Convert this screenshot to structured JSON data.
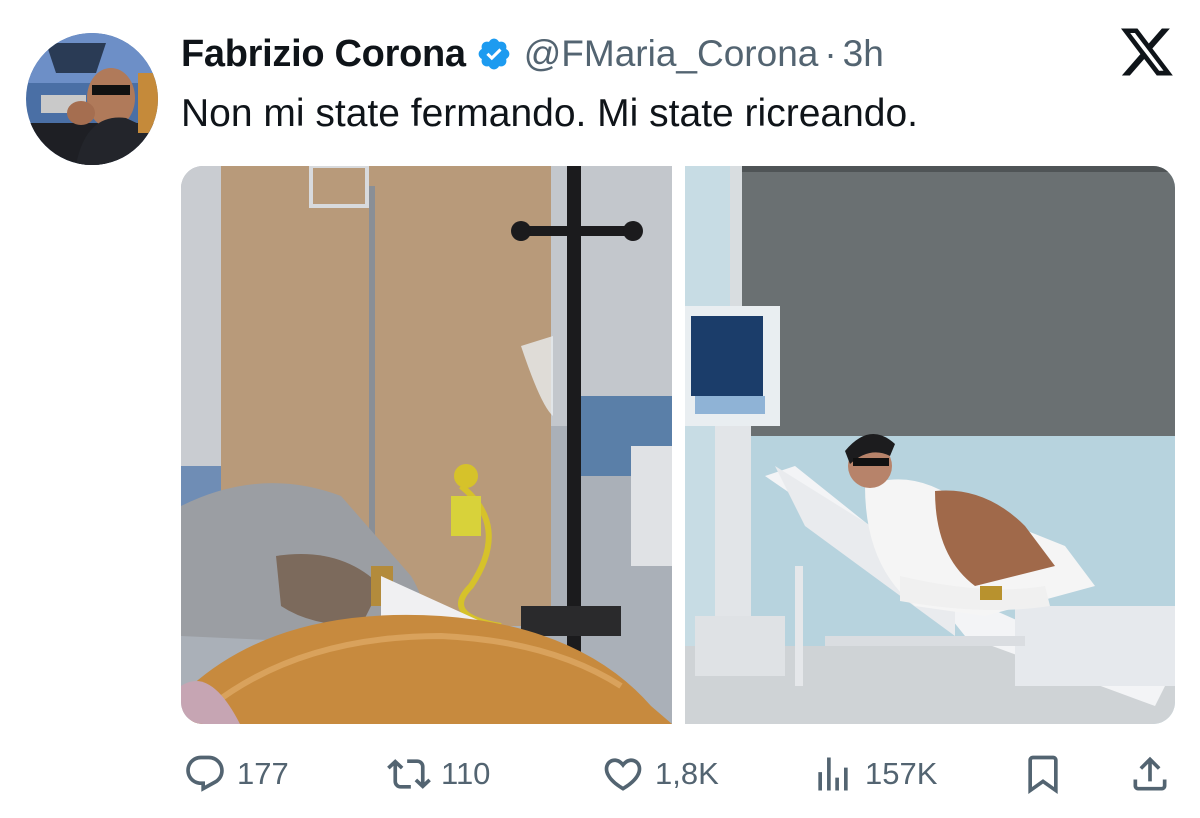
{
  "tweet": {
    "display_name": "Fabrizio Corona",
    "handle": "@FMaria_Corona",
    "separator": "·",
    "time": "3h",
    "text": "Non mi state fermando. Mi state ricreando.",
    "verified": true
  },
  "icons": {
    "verified": "verified-badge-icon",
    "brand": "x-logo-icon",
    "reply": "comment-icon",
    "retweet": "retweet-icon",
    "like": "heart-icon",
    "views": "views-chart-icon",
    "bookmark": "bookmark-icon",
    "share": "share-icon"
  },
  "stats": {
    "replies": "177",
    "retweets": "110",
    "likes": "1,8K",
    "views": "157K"
  },
  "colors": {
    "text": "#0f1419",
    "secondary": "#536471",
    "verified_blue": "#1d9bf0"
  }
}
